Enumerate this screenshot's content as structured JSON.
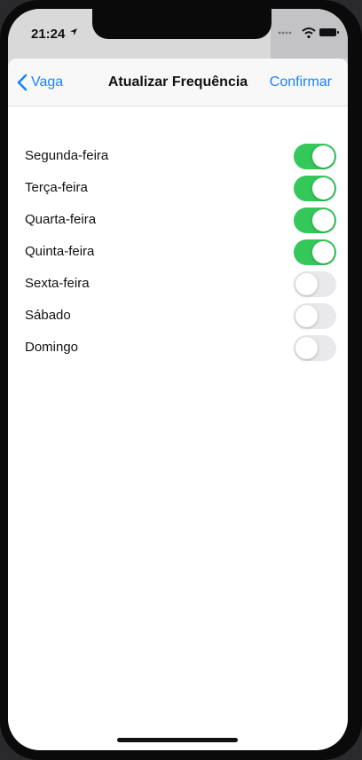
{
  "status_bar": {
    "time": "21:24"
  },
  "nav": {
    "back_label": "Vaga",
    "title": "Atualizar Frequência",
    "confirm_label": "Confirmar"
  },
  "days": [
    {
      "label": "Segunda-feira",
      "on": true
    },
    {
      "label": "Terça-feira",
      "on": true
    },
    {
      "label": "Quarta-feira",
      "on": true
    },
    {
      "label": "Quinta-feira",
      "on": true
    },
    {
      "label": "Sexta-feira",
      "on": false
    },
    {
      "label": "Sábado",
      "on": false
    },
    {
      "label": "Domingo",
      "on": false
    }
  ],
  "colors": {
    "accent": "#1a82fb",
    "toggle_on": "#34c759",
    "toggle_off": "#e9e9eb"
  }
}
